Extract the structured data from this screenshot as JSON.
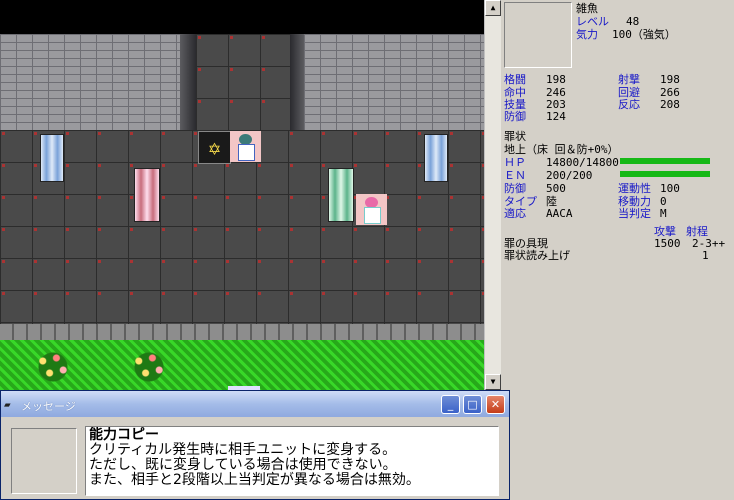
{
  "status": {
    "unit_name": "雑魚",
    "level_label": "レベル",
    "level_value": "48",
    "morale_label": "気力",
    "morale_value": "100（強気）",
    "stats": [
      {
        "label": "格闘",
        "value": "198"
      },
      {
        "label": "命中",
        "value": "246"
      },
      {
        "label": "技量",
        "value": "203"
      },
      {
        "label": "防御",
        "value": "124"
      },
      {
        "label": "射撃",
        "value": "198"
      },
      {
        "label": "回避",
        "value": "266"
      },
      {
        "label": "反応",
        "value": "208"
      }
    ],
    "unit_class": "罪状",
    "terrain": "地上（床 回＆防+0%）",
    "hp_label": "ＨＰ",
    "hp_value": "14800/14800",
    "hp_fraction": 1.0,
    "en_label": "ＥＮ",
    "en_value": "200/200",
    "en_fraction": 1.0,
    "armor_label": "防御",
    "armor_value": "500",
    "mobility_label": "運動性",
    "mobility_value": "100",
    "type_label": "タイプ",
    "type_value": "陸",
    "move_label": "移動力",
    "move_value": "0",
    "adapt_label": "適応",
    "adapt_value": "AACA",
    "size_label": "当判定",
    "size_value": "M",
    "weapon_header_attack": "攻撃",
    "weapon_header_range": "射程",
    "weapons": [
      {
        "name": "罪の具現",
        "attack": "1500",
        "range": "2-3++"
      },
      {
        "name": "罪状読み上げ",
        "attack": "",
        "range": "1"
      }
    ],
    "bar_color": "#16b816"
  },
  "message_window": {
    "title": "メッセージ",
    "lines": [
      "能力コピー",
      "クリティカル発生時に相手ユニットに変身する。",
      "ただし、既に変身している場合は使用できない。",
      "また、相手と2段階以上当判定が異なる場合は無効。"
    ]
  },
  "map": {
    "unit_icons": [
      "star-of-david-icon",
      "girl-unit-icon",
      "pink-girl-unit-icon"
    ],
    "sigil_glyph": "✡"
  },
  "scrollbar": {
    "up_glyph": "▲",
    "down_glyph": "▼"
  },
  "titlebar_buttons": {
    "min": "_",
    "max": "□",
    "close": "✕"
  }
}
